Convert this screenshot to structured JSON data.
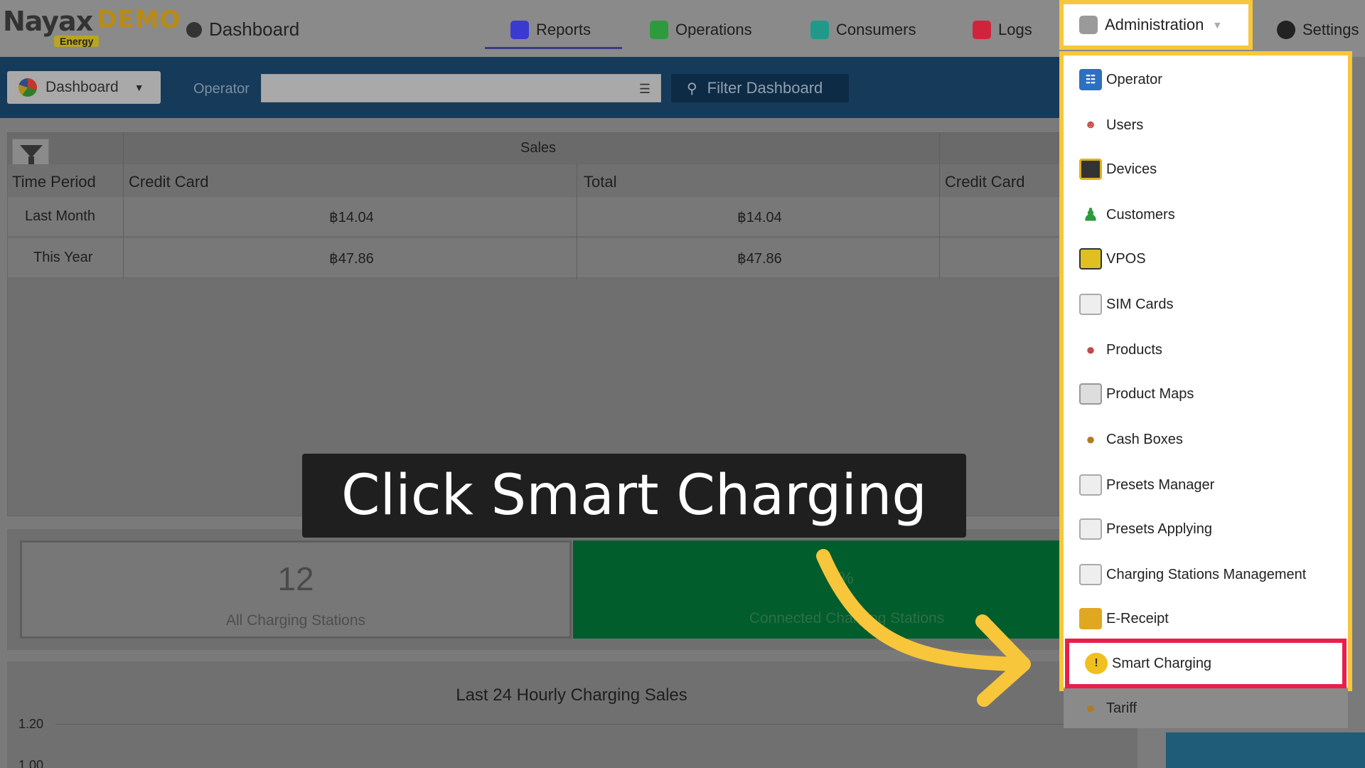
{
  "header": {
    "logo_primary": "Nayax",
    "logo_secondary": "DEMO",
    "logo_tag": "Energy",
    "dashboard_label": "Dashboard",
    "tabs": [
      {
        "label": "Reports",
        "icon": "reports-icon",
        "color": "#3a3ad0"
      },
      {
        "label": "Operations",
        "icon": "operations-icon",
        "color": "#2e9a3e"
      },
      {
        "label": "Consumers",
        "icon": "consumers-icon",
        "color": "#1f9a8a"
      },
      {
        "label": "Logs",
        "icon": "logs-icon",
        "color": "#d0243c"
      },
      {
        "label": "Administration",
        "icon": "administration-icon",
        "color": "#9a9a9a"
      },
      {
        "label": "Settings",
        "icon": "settings-icon",
        "color": "#222222"
      }
    ]
  },
  "toolbar": {
    "dashboard_select": "Dashboard",
    "operator_label": "Operator",
    "operator_value": "",
    "filter_button": "Filter Dashboard"
  },
  "sales_table": {
    "group_header": "Sales",
    "columns": [
      "Time Period",
      "Credit Card",
      "Total",
      "Credit Card"
    ],
    "rows": [
      {
        "period": "Last Month",
        "credit_card": "฿14.04",
        "total": "฿14.04"
      },
      {
        "period": "This Year",
        "credit_card": "฿47.86",
        "total": "฿47.86"
      }
    ]
  },
  "stats": {
    "all_stations_value": "12",
    "all_stations_label": "All Charging Stations",
    "connected_value": "0%",
    "connected_label": "Connected Charging Stations"
  },
  "chart_data": {
    "type": "line",
    "title": "Last 24 Hourly Charging Sales",
    "y_ticks": [
      "1.20",
      "1.00"
    ],
    "series": []
  },
  "admin_menu": {
    "items": [
      {
        "label": "Operator",
        "icon": "operator-icon"
      },
      {
        "label": "Users",
        "icon": "users-icon"
      },
      {
        "label": "Devices",
        "icon": "devices-icon"
      },
      {
        "label": "Customers",
        "icon": "customers-icon"
      },
      {
        "label": "VPOS",
        "icon": "vpos-icon"
      },
      {
        "label": "SIM Cards",
        "icon": "sim-cards-icon"
      },
      {
        "label": "Products",
        "icon": "products-icon"
      },
      {
        "label": "Product Maps",
        "icon": "product-maps-icon"
      },
      {
        "label": "Cash Boxes",
        "icon": "cash-boxes-icon"
      },
      {
        "label": "Presets Manager",
        "icon": "presets-manager-icon"
      },
      {
        "label": "Presets Applying",
        "icon": "presets-applying-icon"
      },
      {
        "label": "Charging Stations Management",
        "icon": "charging-stations-icon"
      },
      {
        "label": "E-Receipt",
        "icon": "e-receipt-icon"
      },
      {
        "label": "Smart Charging",
        "icon": "smart-charging-icon",
        "highlighted": true
      },
      {
        "label": "Tariff",
        "icon": "tariff-icon"
      }
    ]
  },
  "caption": {
    "text": "Click Smart Charging"
  },
  "colors": {
    "highlight_yellow": "#f7c63a",
    "highlight_red": "#e91e4a",
    "toolbar_blue": "#163a59",
    "connected_green": "#015d2c"
  }
}
